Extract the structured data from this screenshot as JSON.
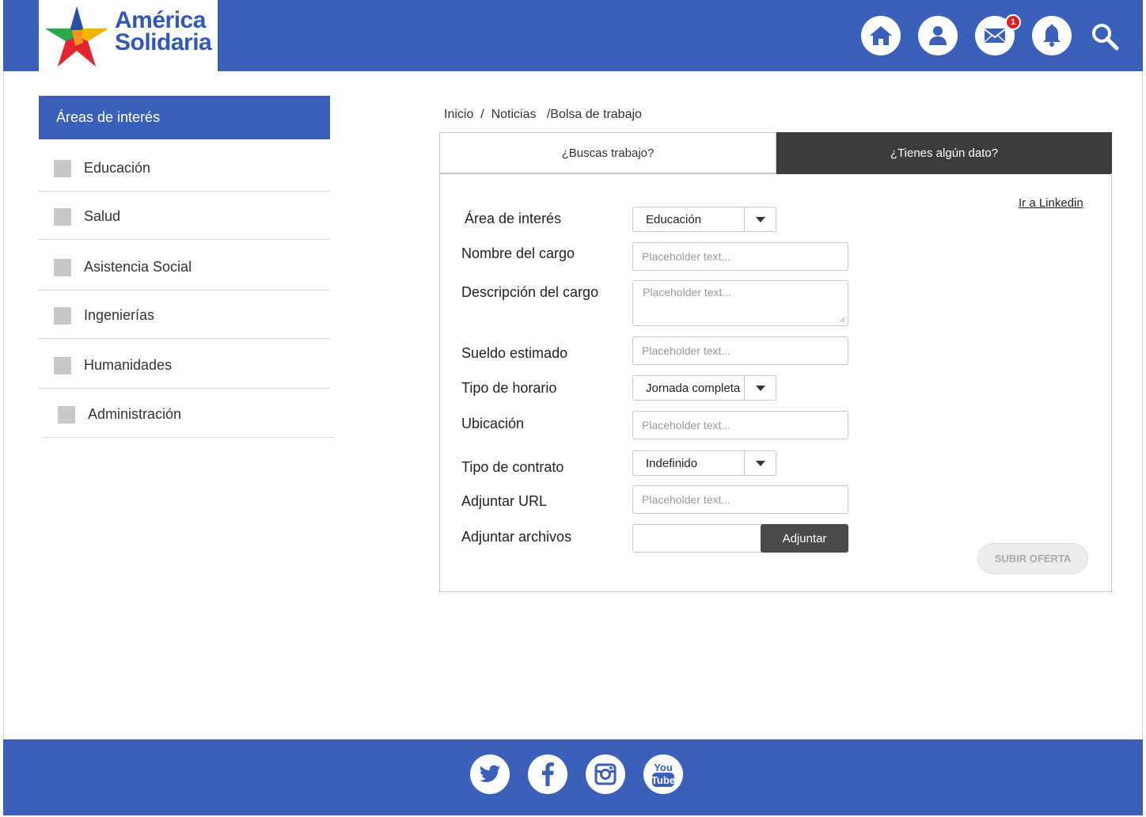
{
  "header": {
    "logo_line1": "América",
    "logo_line2": "Solidaria",
    "notification_count": "1"
  },
  "sidebar": {
    "title": "Áreas de interés",
    "items": [
      {
        "label": "Educación"
      },
      {
        "label": "Salud"
      },
      {
        "label": "Asistencia Social"
      },
      {
        "label": "Ingenierías"
      },
      {
        "label": "Humanidades"
      },
      {
        "label": "Administración"
      }
    ]
  },
  "breadcrumb": {
    "home": "Inicio",
    "sep1": "  /  ",
    "news": "Noticias",
    "current": "   /Bolsa de trabajo"
  },
  "tabs": [
    {
      "label": "¿Buscas trabajo?"
    },
    {
      "label": "¿Tienes algún dato?"
    }
  ],
  "form": {
    "linkedin_link": "Ir a Linkedin",
    "area_label": "Área de interés",
    "area_value": "Educación",
    "cargo_label": "Nombre del cargo",
    "cargo_placeholder": "Placeholder text...",
    "descripcion_label": "Descripción del cargo",
    "descripcion_placeholder": "Placeholder text...",
    "sueldo_label": "Sueldo estimado",
    "sueldo_placeholder": "Placeholder text...",
    "horario_label": "Tipo de horario",
    "horario_value": "Jornada completa",
    "ubicacion_label": "Ubicación",
    "ubicacion_placeholder": "Placeholder text...",
    "contrato_label": "Tipo de contrato",
    "contrato_value": "Indefinido",
    "url_label": "Adjuntar URL",
    "url_placeholder": "Placeholder text...",
    "archivos_label": "Adjuntar archivos",
    "attach_button": "Adjuntar",
    "submit_button": "SUBIR OFERTA"
  },
  "footer": {
    "social": [
      "twitter-icon",
      "facebook-icon",
      "instagram-icon",
      "youtube-icon"
    ],
    "youtube_top": "You",
    "youtube_bottom": "Tube"
  },
  "colors": {
    "brand_blue": "#3a60b9",
    "dark_tab": "#3c3c3c",
    "badge_red": "#e02020"
  }
}
